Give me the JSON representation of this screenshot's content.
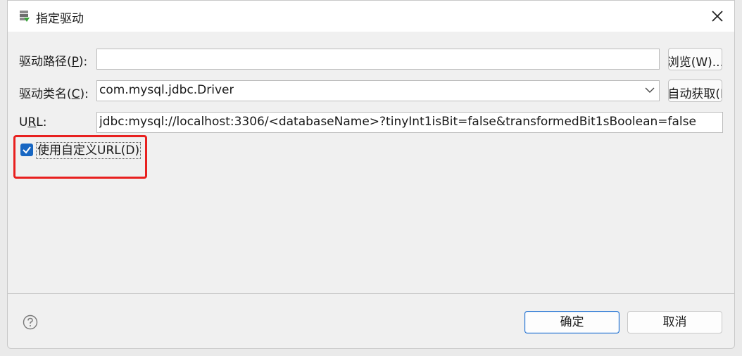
{
  "window": {
    "title": "指定驱动"
  },
  "driver_path": {
    "label": "驱动路径(",
    "mnemonic": "P",
    "suffix": "):",
    "value": ""
  },
  "browse_button": {
    "label": "浏览(W)..."
  },
  "driver_class": {
    "label": "驱动类名(",
    "mnemonic": "C",
    "suffix": "):",
    "value": "com.mysql.jdbc.Driver"
  },
  "auto_fetch_button": {
    "label": "自动获取(I"
  },
  "url": {
    "label_prefix": "U",
    "label_mnemonic": "R",
    "label_suffix": "L:",
    "value": "jdbc:mysql://localhost:3306/<databaseName>?tinyInt1isBit=false&transformedBit1sBoolean=false"
  },
  "custom_url": {
    "checked": true,
    "label": "使用自定义URL(D)"
  },
  "footer": {
    "ok_label": "确定",
    "cancel_label": "取消"
  },
  "colors": {
    "checkbox": "#1766c2",
    "highlight": "#e8201f",
    "ok_border": "#1e6fd0"
  },
  "icons": [
    "driver-icon",
    "close-icon",
    "chevron-down-icon",
    "check-icon",
    "help-icon"
  ]
}
